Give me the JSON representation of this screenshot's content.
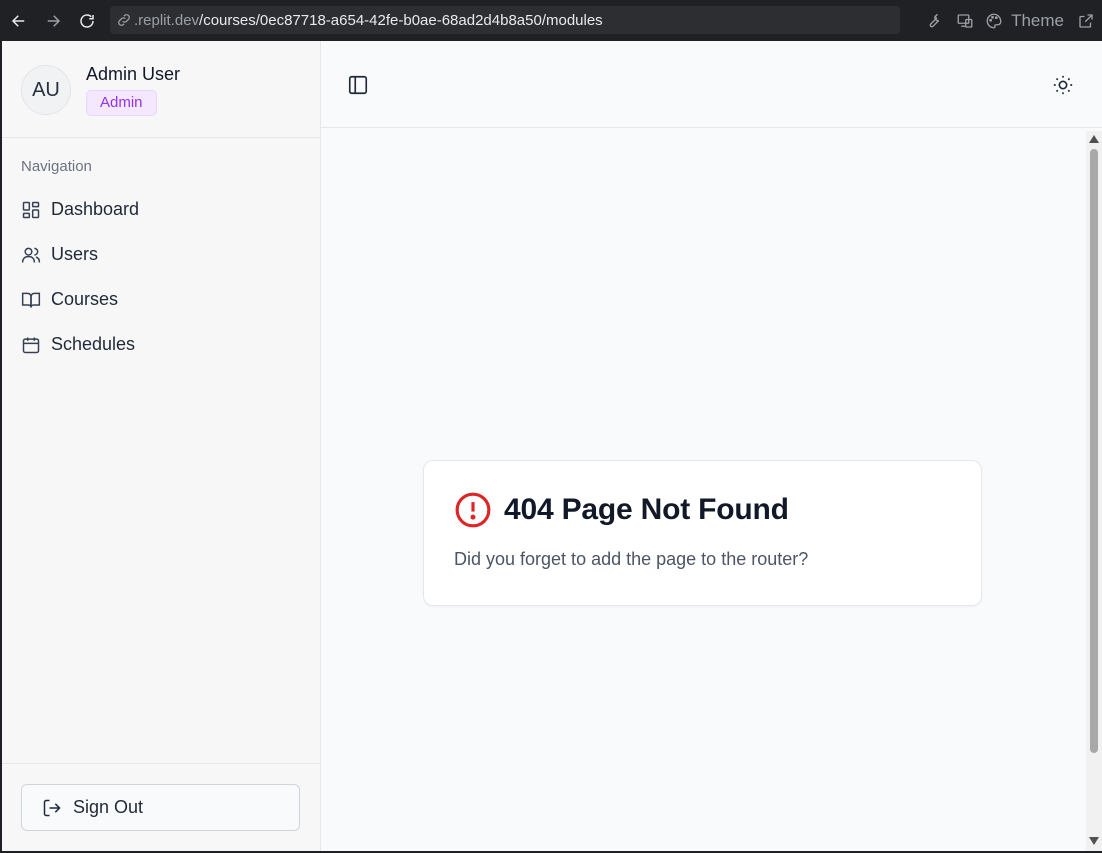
{
  "browser": {
    "url_host": ".replit.dev",
    "url_path": "/courses/0ec87718-a654-42fe-b0ae-68ad2d4b8a50/modules",
    "theme_label": "Theme"
  },
  "sidebar": {
    "user": {
      "initials": "AU",
      "name": "Admin User",
      "role": "Admin"
    },
    "nav_heading": "Navigation",
    "items": [
      {
        "label": "Dashboard",
        "icon": "dashboard-icon"
      },
      {
        "label": "Users",
        "icon": "users-icon"
      },
      {
        "label": "Courses",
        "icon": "book-icon"
      },
      {
        "label": "Schedules",
        "icon": "calendar-icon"
      }
    ],
    "sign_out_label": "Sign Out"
  },
  "error_card": {
    "title": "404 Page Not Found",
    "message": "Did you forget to add the page to the router?",
    "icon": "alert-circle-icon",
    "icon_color": "#dc2626"
  },
  "colors": {
    "badge_bg": "#f3e8ff",
    "badge_text": "#9333ea",
    "chrome_bg": "#202124"
  }
}
